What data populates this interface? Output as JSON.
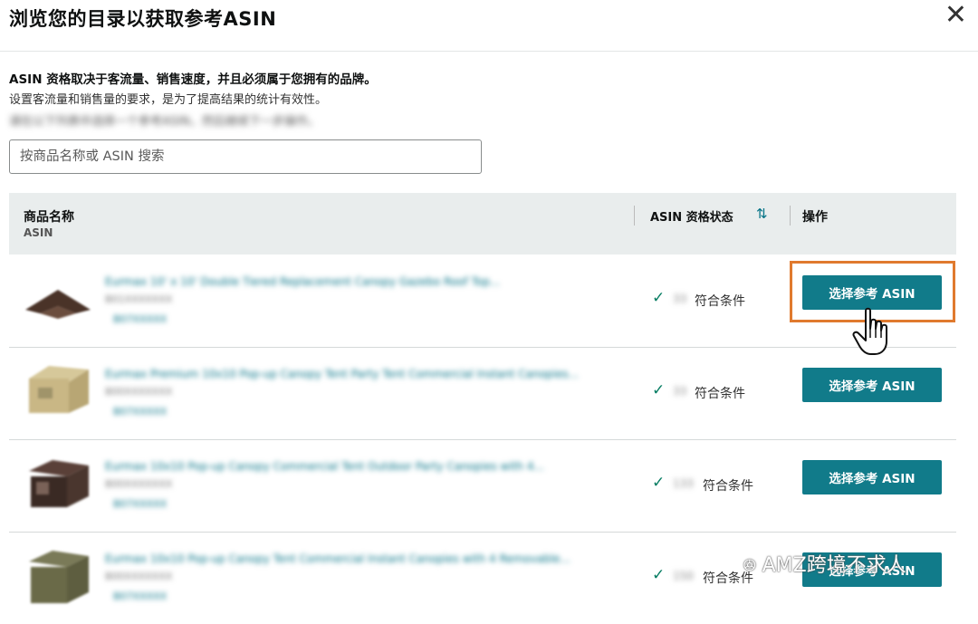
{
  "modal": {
    "title": "浏览您的目录以获取参考ASIN",
    "close_glyph": "✕"
  },
  "intro": {
    "line1": "ASIN 资格取决于客流量、销售速度，并且必须属于您拥有的品牌。",
    "line2": "设置客流量和销售量的要求，是为了提高结果的统计有效性。",
    "blurred_note": "请在以下列表中选择一个参考ASIN，然后继续下一步操作。"
  },
  "search": {
    "placeholder": "按商品名称或 ASIN 搜索"
  },
  "table": {
    "col_name": "商品名称",
    "col_name_sub": "ASIN",
    "col_status": "ASIN 资格状态",
    "sort_glyph": "⇅",
    "col_action": "操作"
  },
  "rows": [
    {
      "title_blurred": "Eurmax 10' x 10' Double Tiered Replacement Canopy Gazebo Roof Top...",
      "sub_blurred": "B01XXXXXXX",
      "link_blurred": "B07XXXXX",
      "count_blurred": "33",
      "status": "符合条件",
      "button": "选择参考 ASIN"
    },
    {
      "title_blurred": "Eurmax Premium 10x10 Pop-up Canopy Tent Party Tent Commercial Instant Canopies...",
      "sub_blurred": "B00XXXXXXX",
      "link_blurred": "B07XXXXX",
      "count_blurred": "33",
      "status": "符合条件",
      "button": "选择参考 ASIN"
    },
    {
      "title_blurred": "Eurmax 10x10 Pop-up Canopy Commercial Tent Outdoor Party Canopies with 4...",
      "sub_blurred": "B00XXXXXXX",
      "link_blurred": "B07XXXXX",
      "count_blurred": "133",
      "status": "符合条件",
      "button": "选择参考 ASIN"
    },
    {
      "title_blurred": "Eurmax 10x10 Pop-up Canopy Tent Commercial Instant Canopies with 4 Removable...",
      "sub_blurred": "B00XXXXXXX",
      "link_blurred": "B07XXXXX",
      "count_blurred": "150",
      "status": "符合条件",
      "button": "选择参考 ASIN"
    }
  ],
  "watermark": {
    "text": "AMZ跨境不求人",
    "logo_glyph": "ꔮ"
  },
  "colors": {
    "button": "#117b8a",
    "highlight": "#e07a2e",
    "header_bg": "#e9eded",
    "check": "#067d62"
  }
}
